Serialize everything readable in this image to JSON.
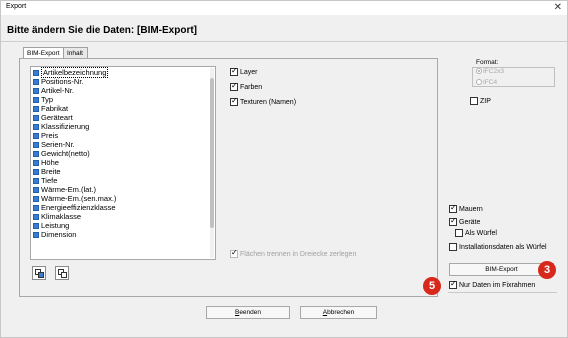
{
  "window": {
    "title": "Export",
    "close_icon": "close-icon"
  },
  "heading": "Bitte ändern Sie die Daten:  [BIM-Export]",
  "tabs": [
    {
      "label": "BIM-Export"
    },
    {
      "label": "Inhalt"
    }
  ],
  "attributes": {
    "items": [
      "Artikelbezeichnung",
      "Positions-Nr.",
      "Artikel-Nr.",
      "Typ",
      "Fabrikat",
      "Geräteart",
      "Klassifizierung",
      "Preis",
      "Serien-Nr.",
      "Gewicht(netto)",
      "Höhe",
      "Breite",
      "Tiefe",
      "Wärme-Em.(lat.)",
      "Wärme-Em.(sen.max.)",
      "Energieeffizienzklasse",
      "Klimaklasse",
      "Leistung",
      "Dimension"
    ],
    "all_checked": true
  },
  "middle_options": {
    "layer": "Layer",
    "farben": "Farben",
    "texturen": "Texturen (Namen)",
    "flaechen": "Flächen trennen in Dreiecke zerlegen"
  },
  "format": {
    "label": "Format:",
    "options": [
      "IFC2x3",
      "IFC4"
    ],
    "selected": "IFC2x3"
  },
  "zip_label": "ZIP",
  "right_options": {
    "mauern": "Mauern",
    "geraete": "Geräte",
    "als_wuerfel": "Als Würfel",
    "installationsdaten": "Installationsdaten als Würfel"
  },
  "bim_export_button": "BIM-Export",
  "nur_daten_label": "Nur Daten im Fixrahmen",
  "badges": {
    "three": "3",
    "five": "5"
  },
  "footer": {
    "beenden_rest": "eenden",
    "beenden_key": "B",
    "abbrechen_rest": "bbrechen",
    "abbrechen_key": "A"
  },
  "colors": {
    "badge": "#d7281b",
    "checkbox_fill": "#3b7bd0"
  }
}
